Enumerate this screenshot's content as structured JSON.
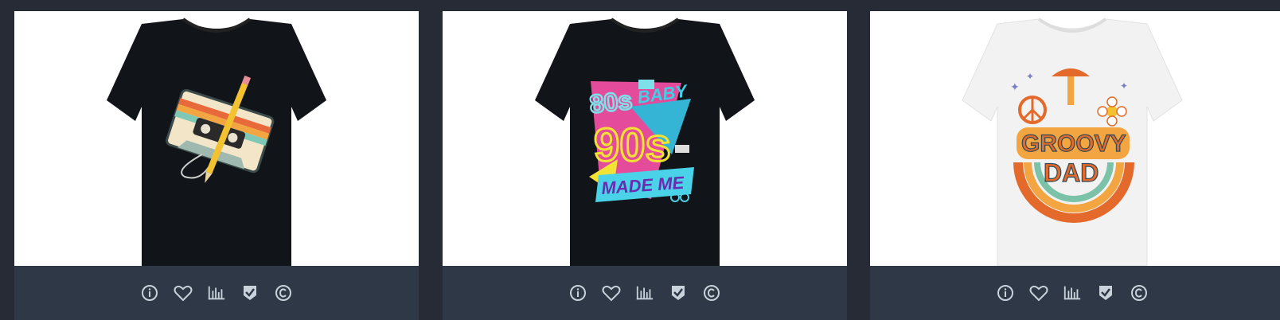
{
  "products": [
    {
      "design": "cassette tape with pencil",
      "shirt_color": "#111418",
      "actions": [
        {
          "name": "info-icon"
        },
        {
          "name": "heart-icon"
        },
        {
          "name": "bar-chart-icon"
        },
        {
          "name": "shield-check-icon"
        },
        {
          "name": "copyright-icon"
        }
      ]
    },
    {
      "design_text": {
        "line1": "80s",
        "line1b": "BABY",
        "line2": "90s",
        "line3": "MADE ME"
      },
      "shirt_color": "#111418",
      "actions": [
        {
          "name": "info-icon"
        },
        {
          "name": "heart-icon"
        },
        {
          "name": "bar-chart-icon"
        },
        {
          "name": "shield-check-icon"
        },
        {
          "name": "copyright-icon"
        }
      ]
    },
    {
      "design_text": {
        "line1": "GROOVY",
        "line2": "DAD"
      },
      "shirt_color": "#f4f4f4",
      "actions": [
        {
          "name": "info-icon"
        },
        {
          "name": "heart-icon"
        },
        {
          "name": "bar-chart-icon"
        },
        {
          "name": "shield-check-icon"
        },
        {
          "name": "copyright-icon"
        }
      ]
    }
  ],
  "colors": {
    "page_bg": "#262b36",
    "action_bar": "#2e3846",
    "icon": "#c9d1db"
  }
}
